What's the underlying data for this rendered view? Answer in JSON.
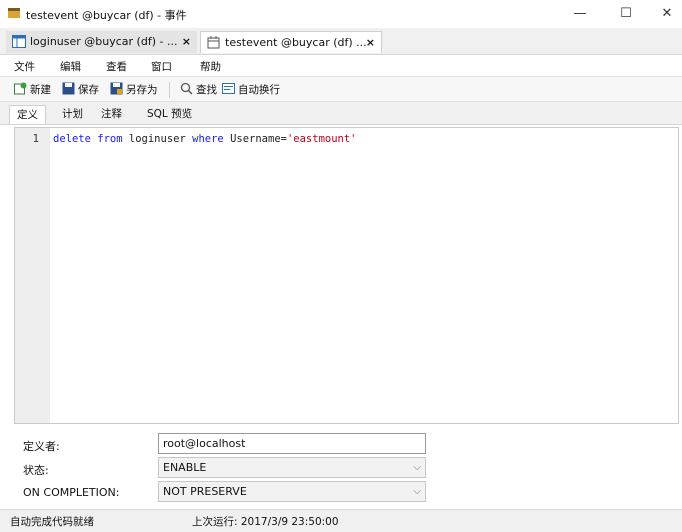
{
  "window": {
    "title": "testevent @buycar (df) - 事件",
    "controls": {
      "minimize": "—",
      "maximize": "☐",
      "close": "✕"
    }
  },
  "tabs": [
    {
      "label": "loginuser @buycar (df) - ...",
      "close": "×",
      "icon": "table-icon"
    },
    {
      "label": "testevent @buycar (df) ...",
      "close": "×",
      "icon": "event-icon"
    }
  ],
  "menu": [
    "文件",
    "编辑",
    "查看",
    "窗口",
    "帮助"
  ],
  "toolbar": {
    "new": "新建",
    "save": "保存",
    "save_as": "另存为",
    "find": "查找",
    "word_wrap": "自动换行"
  },
  "subtabs": [
    "定义",
    "计划",
    "注释",
    "SQL 预览"
  ],
  "editor": {
    "line_number": "1",
    "tokens": {
      "kw_delete": "delete",
      "kw_from": "from",
      "table": "loginuser",
      "kw_where": "where",
      "column": "Username=",
      "value": "'eastmount'"
    }
  },
  "form": {
    "definer": {
      "label": "定义者:",
      "value": "root@localhost"
    },
    "status": {
      "label": "状态:",
      "value": "ENABLE"
    },
    "on_completion": {
      "label": "ON COMPLETION:",
      "value": "NOT PRESERVE"
    }
  },
  "statusbar": {
    "left": "自动完成代码就绪",
    "right": "上次运行: 2017/3/9 23:50:00"
  }
}
